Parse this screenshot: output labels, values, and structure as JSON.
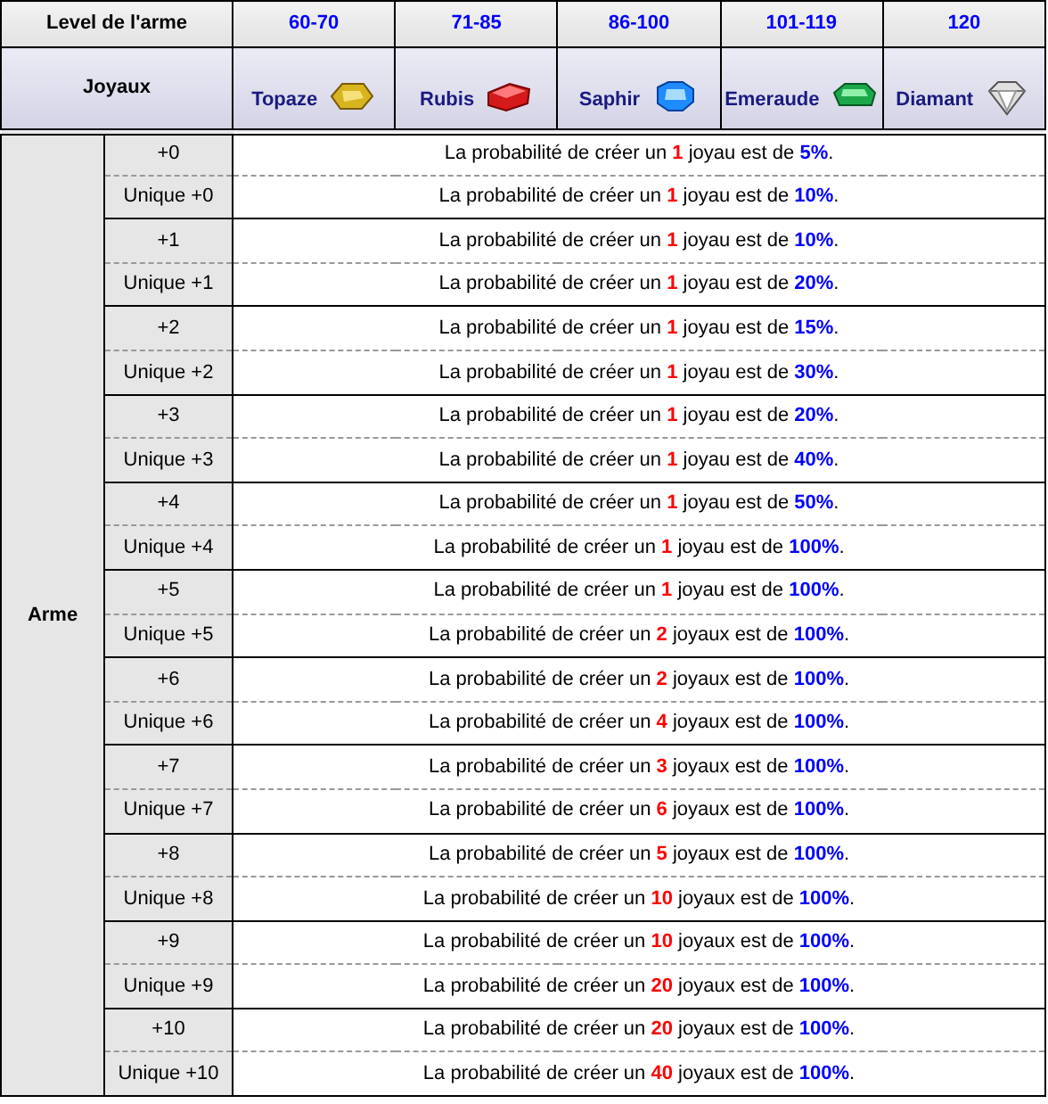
{
  "header": {
    "label": "Level de l'arme",
    "levels": [
      "60-70",
      "71-85",
      "86-100",
      "101-119",
      "120"
    ]
  },
  "jewels": {
    "label": "Joyaux",
    "gems": [
      {
        "name": "Topaze"
      },
      {
        "name": "Rubis"
      },
      {
        "name": "Saphir"
      },
      {
        "name": "Emeraude"
      },
      {
        "name": "Diamant"
      }
    ]
  },
  "body": {
    "group": "Arme",
    "rows": [
      {
        "upgrade": "+0",
        "sentence": "La probabilité de créer un **1** joyau est de **5%**."
      },
      {
        "upgrade": "Unique +0",
        "sentence": "La probabilité de créer un **1** joyau est de **10%**."
      },
      {
        "upgrade": "+1",
        "sentence": "La probabilité de créer un **1** joyau est de **10%**."
      },
      {
        "upgrade": "Unique +1",
        "sentence": "La probabilité de créer un **1** joyau est de **20%**."
      },
      {
        "upgrade": "+2",
        "sentence": "La probabilité de créer un **1** joyau est de **15%**."
      },
      {
        "upgrade": "Unique +2",
        "sentence": "La probabilité de créer un **1** joyau est de **30%**."
      },
      {
        "upgrade": "+3",
        "sentence": "La probabilité de créer un **1** joyau est de **20%**."
      },
      {
        "upgrade": "Unique +3",
        "sentence": "La probabilité de créer un **1** joyau est de **40%**."
      },
      {
        "upgrade": "+4",
        "sentence": "La probabilité de créer un **1** joyau est de **50%**."
      },
      {
        "upgrade": "Unique +4",
        "sentence": "La probabilité de créer un **1** joyau est de **100%**."
      },
      {
        "upgrade": "+5",
        "sentence": "La probabilité de créer un **1** joyau est de **100%**."
      },
      {
        "upgrade": "Unique +5",
        "sentence": "La probabilité de créer un **2** joyaux est de **100%**."
      },
      {
        "upgrade": "+6",
        "sentence": "La probabilité de créer un **2** joyaux est de **100%**."
      },
      {
        "upgrade": "Unique +6",
        "sentence": "La probabilité de créer un **4** joyaux est de **100%**."
      },
      {
        "upgrade": "+7",
        "sentence": "La probabilité de créer un **3** joyaux est de **100%**."
      },
      {
        "upgrade": "Unique +7",
        "sentence": "La probabilité de créer un **6** joyaux est de **100%**."
      },
      {
        "upgrade": "+8",
        "sentence": "La probabilité de créer un **5** joyaux est de **100%**."
      },
      {
        "upgrade": "Unique +8",
        "sentence": "La probabilité de créer un **10** joyaux est de **100%**."
      },
      {
        "upgrade": "+9",
        "sentence": "La probabilité de créer un **10** joyaux est de **100%**."
      },
      {
        "upgrade": "Unique +9",
        "sentence": "La probabilité de créer un **20** joyaux est de **100%**."
      },
      {
        "upgrade": "+10",
        "sentence": "La probabilité de créer un **20** joyaux est de **100%**."
      },
      {
        "upgrade": "Unique +10",
        "sentence": "La probabilité de créer un **40** joyaux est de **100%**."
      }
    ]
  }
}
